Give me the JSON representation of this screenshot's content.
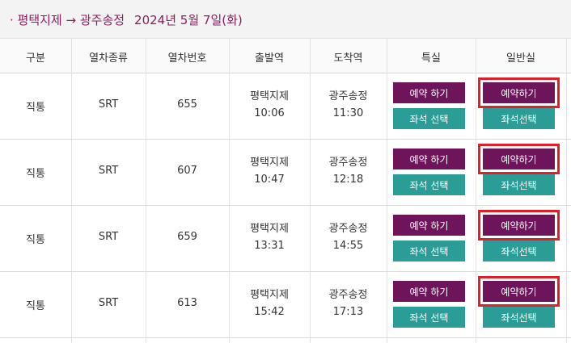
{
  "header": {
    "route": "· 평택지제 → 광주송정",
    "date": "2024년 5월 7일(화)"
  },
  "columns": [
    "구분",
    "열차종류",
    "열차번호",
    "출발역",
    "도착역",
    "특실",
    "일반실"
  ],
  "rows": [
    {
      "type": "직통",
      "train": "SRT",
      "number": "655",
      "dep_station": "평택지제",
      "dep_time": "10:06",
      "arr_station": "광주송정",
      "arr_time": "11:30",
      "special_reserve": "예약 하기",
      "special_seat": "좌석 선택",
      "general_reserve": "예약하기",
      "general_seat": "좌석선택"
    },
    {
      "type": "직통",
      "train": "SRT",
      "number": "607",
      "dep_station": "평택지제",
      "dep_time": "10:47",
      "arr_station": "광주송정",
      "arr_time": "12:18",
      "special_reserve": "예약 하기",
      "special_seat": "좌석 선택",
      "general_reserve": "예약하기",
      "general_seat": "좌석선택"
    },
    {
      "type": "직통",
      "train": "SRT",
      "number": "659",
      "dep_station": "평택지제",
      "dep_time": "13:31",
      "arr_station": "광주송정",
      "arr_time": "14:55",
      "special_reserve": "예약 하기",
      "special_seat": "좌석 선택",
      "general_reserve": "예약하기",
      "general_seat": "좌석선택"
    },
    {
      "type": "직통",
      "train": "SRT",
      "number": "613",
      "dep_station": "평택지제",
      "dep_time": "15:42",
      "arr_station": "광주송정",
      "arr_time": "17:13",
      "special_reserve": "예약 하기",
      "special_seat": "좌석 선택",
      "general_reserve": "예약하기",
      "general_seat": "좌석선택"
    }
  ],
  "colors": {
    "accent": "#8a1f5c",
    "reserve_button": "#6d145a",
    "seat_button": "#2a9d97",
    "highlight": "#e31e26"
  }
}
